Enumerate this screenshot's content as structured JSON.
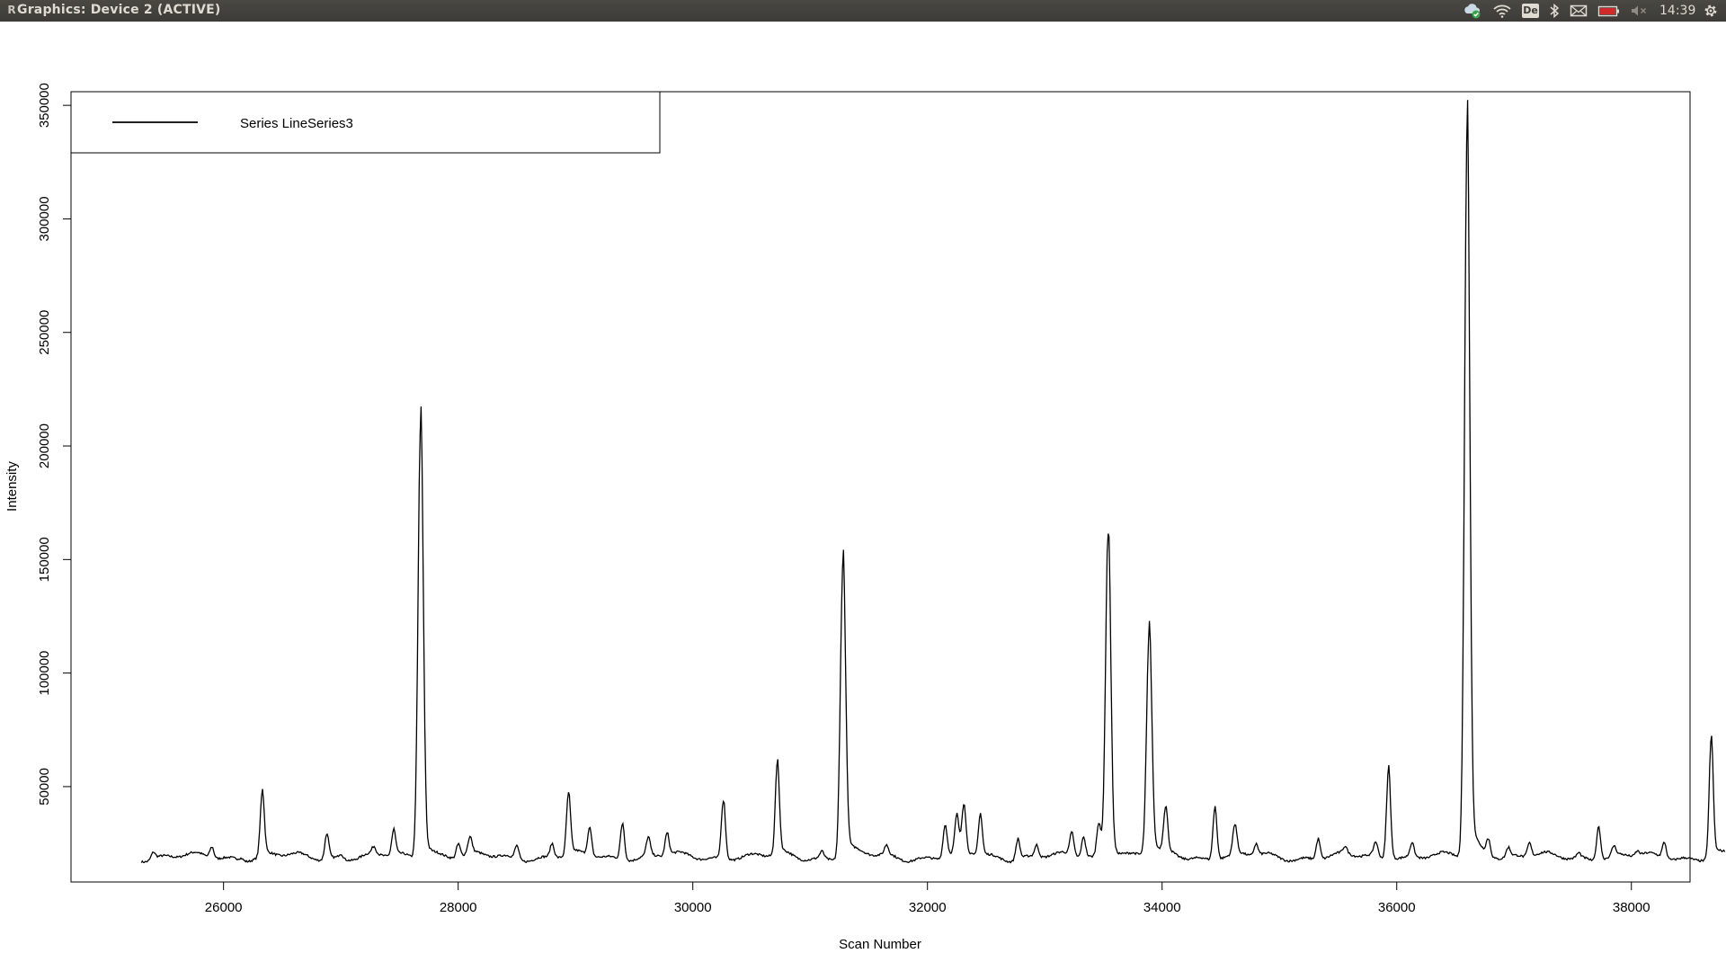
{
  "window": {
    "title": "Graphics: Device 2 (ACTIVE)"
  },
  "panel": {
    "clock": "14:39",
    "keyboard_layout": "De"
  },
  "icons": {
    "app": "r-logo-icon",
    "sync": "cloud-sync-icon",
    "network": "wifi-icon",
    "bluetooth": "bluetooth-icon",
    "messages": "mail-icon",
    "battery": "battery-low-icon",
    "volume": "volume-muted-icon",
    "system": "gear-icon"
  },
  "colors": {
    "panel_bg": "#3c3b37",
    "panel_text": "#dfdbd2",
    "battery_alert": "#d22a2a",
    "line": "#000000"
  },
  "chart_data": {
    "type": "line",
    "title": "",
    "xlabel": "Scan Number",
    "ylabel": "Intensity",
    "xlim": [
      24700,
      38500
    ],
    "ylim": [
      8000,
      356000
    ],
    "xticks": [
      26000,
      28000,
      30000,
      32000,
      34000,
      36000,
      38000
    ],
    "yticks": [
      50000,
      100000,
      150000,
      200000,
      250000,
      300000,
      350000
    ],
    "grid": false,
    "legend": {
      "position": "top-left",
      "entries": [
        "Series LineSeries3"
      ]
    },
    "baseline": 19000,
    "x_range": [
      25300,
      38800
    ],
    "peaks": [
      [
        25400,
        22000
      ],
      [
        25900,
        24000
      ],
      [
        26150,
        20000
      ],
      [
        26330,
        47000
      ],
      [
        26880,
        30000
      ],
      [
        27000,
        21000
      ],
      [
        27280,
        22000
      ],
      [
        27450,
        30000
      ],
      [
        27680,
        211000
      ],
      [
        28000,
        25000
      ],
      [
        28100,
        26000
      ],
      [
        28500,
        25000
      ],
      [
        28800,
        25000
      ],
      [
        28940,
        46000
      ],
      [
        29120,
        31000
      ],
      [
        29400,
        35000
      ],
      [
        29620,
        27000
      ],
      [
        29780,
        29000
      ],
      [
        30260,
        45000
      ],
      [
        30720,
        59000
      ],
      [
        31100,
        22000
      ],
      [
        31280,
        149000
      ],
      [
        31650,
        23000
      ],
      [
        32150,
        33000
      ],
      [
        32250,
        35000
      ],
      [
        32310,
        40000
      ],
      [
        32450,
        37000
      ],
      [
        32770,
        28000
      ],
      [
        32930,
        24000
      ],
      [
        33230,
        29000
      ],
      [
        33330,
        28000
      ],
      [
        33460,
        34000
      ],
      [
        33540,
        163000
      ],
      [
        33890,
        117000
      ],
      [
        34030,
        38000
      ],
      [
        34450,
        42000
      ],
      [
        34620,
        32000
      ],
      [
        34800,
        24000
      ],
      [
        35330,
        28000
      ],
      [
        35560,
        22000
      ],
      [
        35820,
        25000
      ],
      [
        35930,
        59000
      ],
      [
        36130,
        25000
      ],
      [
        36600,
        339000
      ],
      [
        36780,
        26000
      ],
      [
        36950,
        23000
      ],
      [
        37130,
        25000
      ],
      [
        37550,
        21000
      ],
      [
        37720,
        34000
      ],
      [
        37850,
        23000
      ],
      [
        38050,
        21000
      ],
      [
        38280,
        26000
      ],
      [
        38680,
        71000
      ]
    ]
  }
}
